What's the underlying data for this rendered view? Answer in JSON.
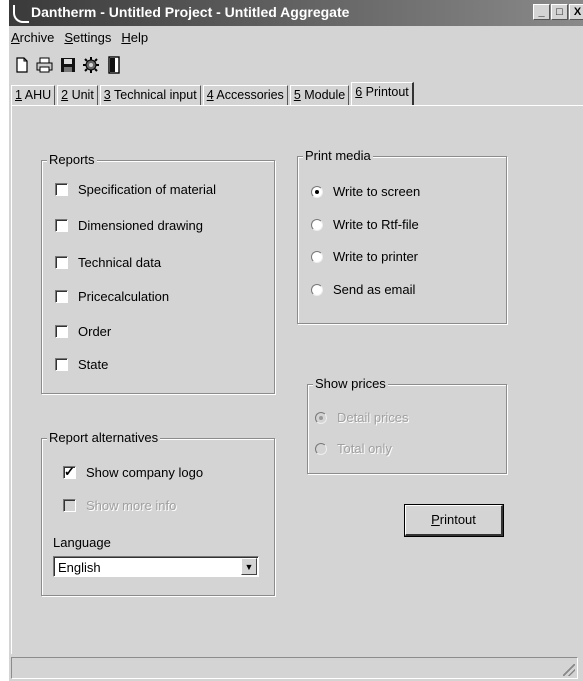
{
  "window": {
    "title": "Dantherm - Untitled Project - Untitled Aggregate",
    "minimize": "_",
    "maximize": "□",
    "close": "X"
  },
  "menu": [
    {
      "label": "Archive",
      "accel": "A",
      "rest": "rchive"
    },
    {
      "label": "Settings",
      "accel": "S",
      "rest": "ettings"
    },
    {
      "label": "Help",
      "accel": "H",
      "rest": "elp"
    }
  ],
  "toolbar": {
    "icons": [
      "new-document-icon",
      "print-preview-icon",
      "save-icon",
      "settings-gear-icon",
      "exit-door-icon"
    ]
  },
  "tabs": [
    {
      "accel": "1",
      "text": " AHU"
    },
    {
      "accel": "2",
      "text": " Unit"
    },
    {
      "accel": "3",
      "text": " Technical input"
    },
    {
      "accel": "4",
      "text": " Accessories"
    },
    {
      "accel": "5",
      "text": " Module"
    },
    {
      "accel": "6",
      "text": " Printout"
    }
  ],
  "reports": {
    "title": "Reports",
    "items": [
      {
        "label": "Specification of material",
        "checked": false
      },
      {
        "label": "Dimensioned drawing",
        "checked": false
      },
      {
        "label": "Technical data",
        "checked": false
      },
      {
        "label": "Pricecalculation",
        "checked": false
      },
      {
        "label": "Order",
        "checked": false
      },
      {
        "label": "State",
        "checked": false
      }
    ]
  },
  "print_media": {
    "title": "Print media",
    "options": [
      {
        "label": "Write to screen",
        "selected": true
      },
      {
        "label": "Write to Rtf-file",
        "selected": false
      },
      {
        "label": "Write to printer",
        "selected": false
      },
      {
        "label": "Send as email",
        "selected": false
      }
    ]
  },
  "show_prices": {
    "title": "Show prices",
    "options": [
      {
        "label": "Detail prices",
        "selected": true,
        "disabled": true
      },
      {
        "label": "Total only",
        "selected": false,
        "disabled": true
      }
    ]
  },
  "report_alternatives": {
    "title": "Report alternatives",
    "show_logo": {
      "label": "Show company logo",
      "checked": true
    },
    "show_more": {
      "label": "Show more info",
      "checked": false,
      "disabled": true
    },
    "language_label": "Language",
    "language_value": "English"
  },
  "printout_button": {
    "accel": "P",
    "rest": "rintout"
  }
}
